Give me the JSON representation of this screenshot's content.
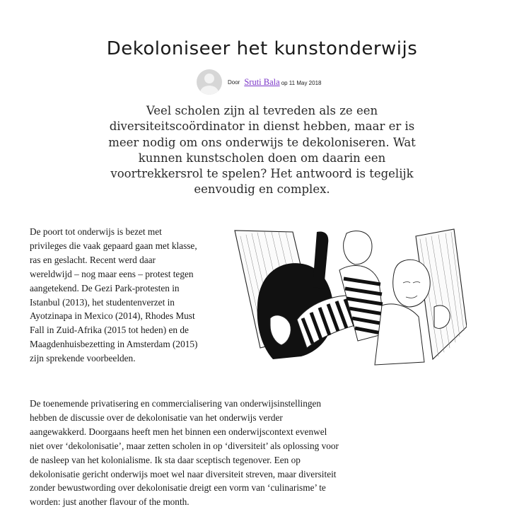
{
  "article": {
    "title": "Dekoloniseer het kunstonderwijs",
    "byline": {
      "prefix": "Door",
      "author": "Sruti Bala",
      "date": "op 11 May 2018"
    },
    "lede": "Veel scholen zijn al tevreden als ze een diversiteitscoördinator in dienst hebben, maar er is meer nodig om ons onderwijs te dekoloniseren. Wat kunnen kunstscholen doen om daarin een voortrekkersrol te spelen? Het antwoord is tegelijk eenvoudig en complex.",
    "paragraphs": [
      "De poort tot onderwijs is bezet met privileges die vaak gepaard gaan met klasse, ras en geslacht. Recent werd daar wereldwijd – nog maar eens – protest tegen aangetekend. De Gezi Park-protesten in Istanbul (2013), het studentenverzet in Ayotzinapa in Mexico (2014), Rhodes Must Fall in Zuid-Afrika (2015 tot heden) en de Maagdenhuisbezetting in Amsterdam (2015) zijn sprekende voorbeelden.",
      "De toenemende privatisering en commercialisering van onderwijsinstellingen hebben de discussie over de dekolonisatie van het onderwijs verder aangewakkerd. Doorgaans heeft men het binnen een onderwijscontext evenwel niet over ‘dekolonisatie’, maar zetten scholen in op ‘diversiteit’ als oplossing voor de nasleep van het kolonialisme. Ik sta daar sceptisch tegenover. Een op dekolonisatie gericht onderwijs moet wel naar diversiteit streven, maar diversiteit zonder bewustwording over dekolonisatie dreigt een vorm van ‘culinarisme’ te worden: just another flavour of the month."
    ]
  },
  "colors": {
    "text": "#1a1a1a",
    "link": "#7a35c8",
    "avatar": "#d6d6d6"
  },
  "icons": {
    "avatar": "default-user-avatar-icon"
  }
}
